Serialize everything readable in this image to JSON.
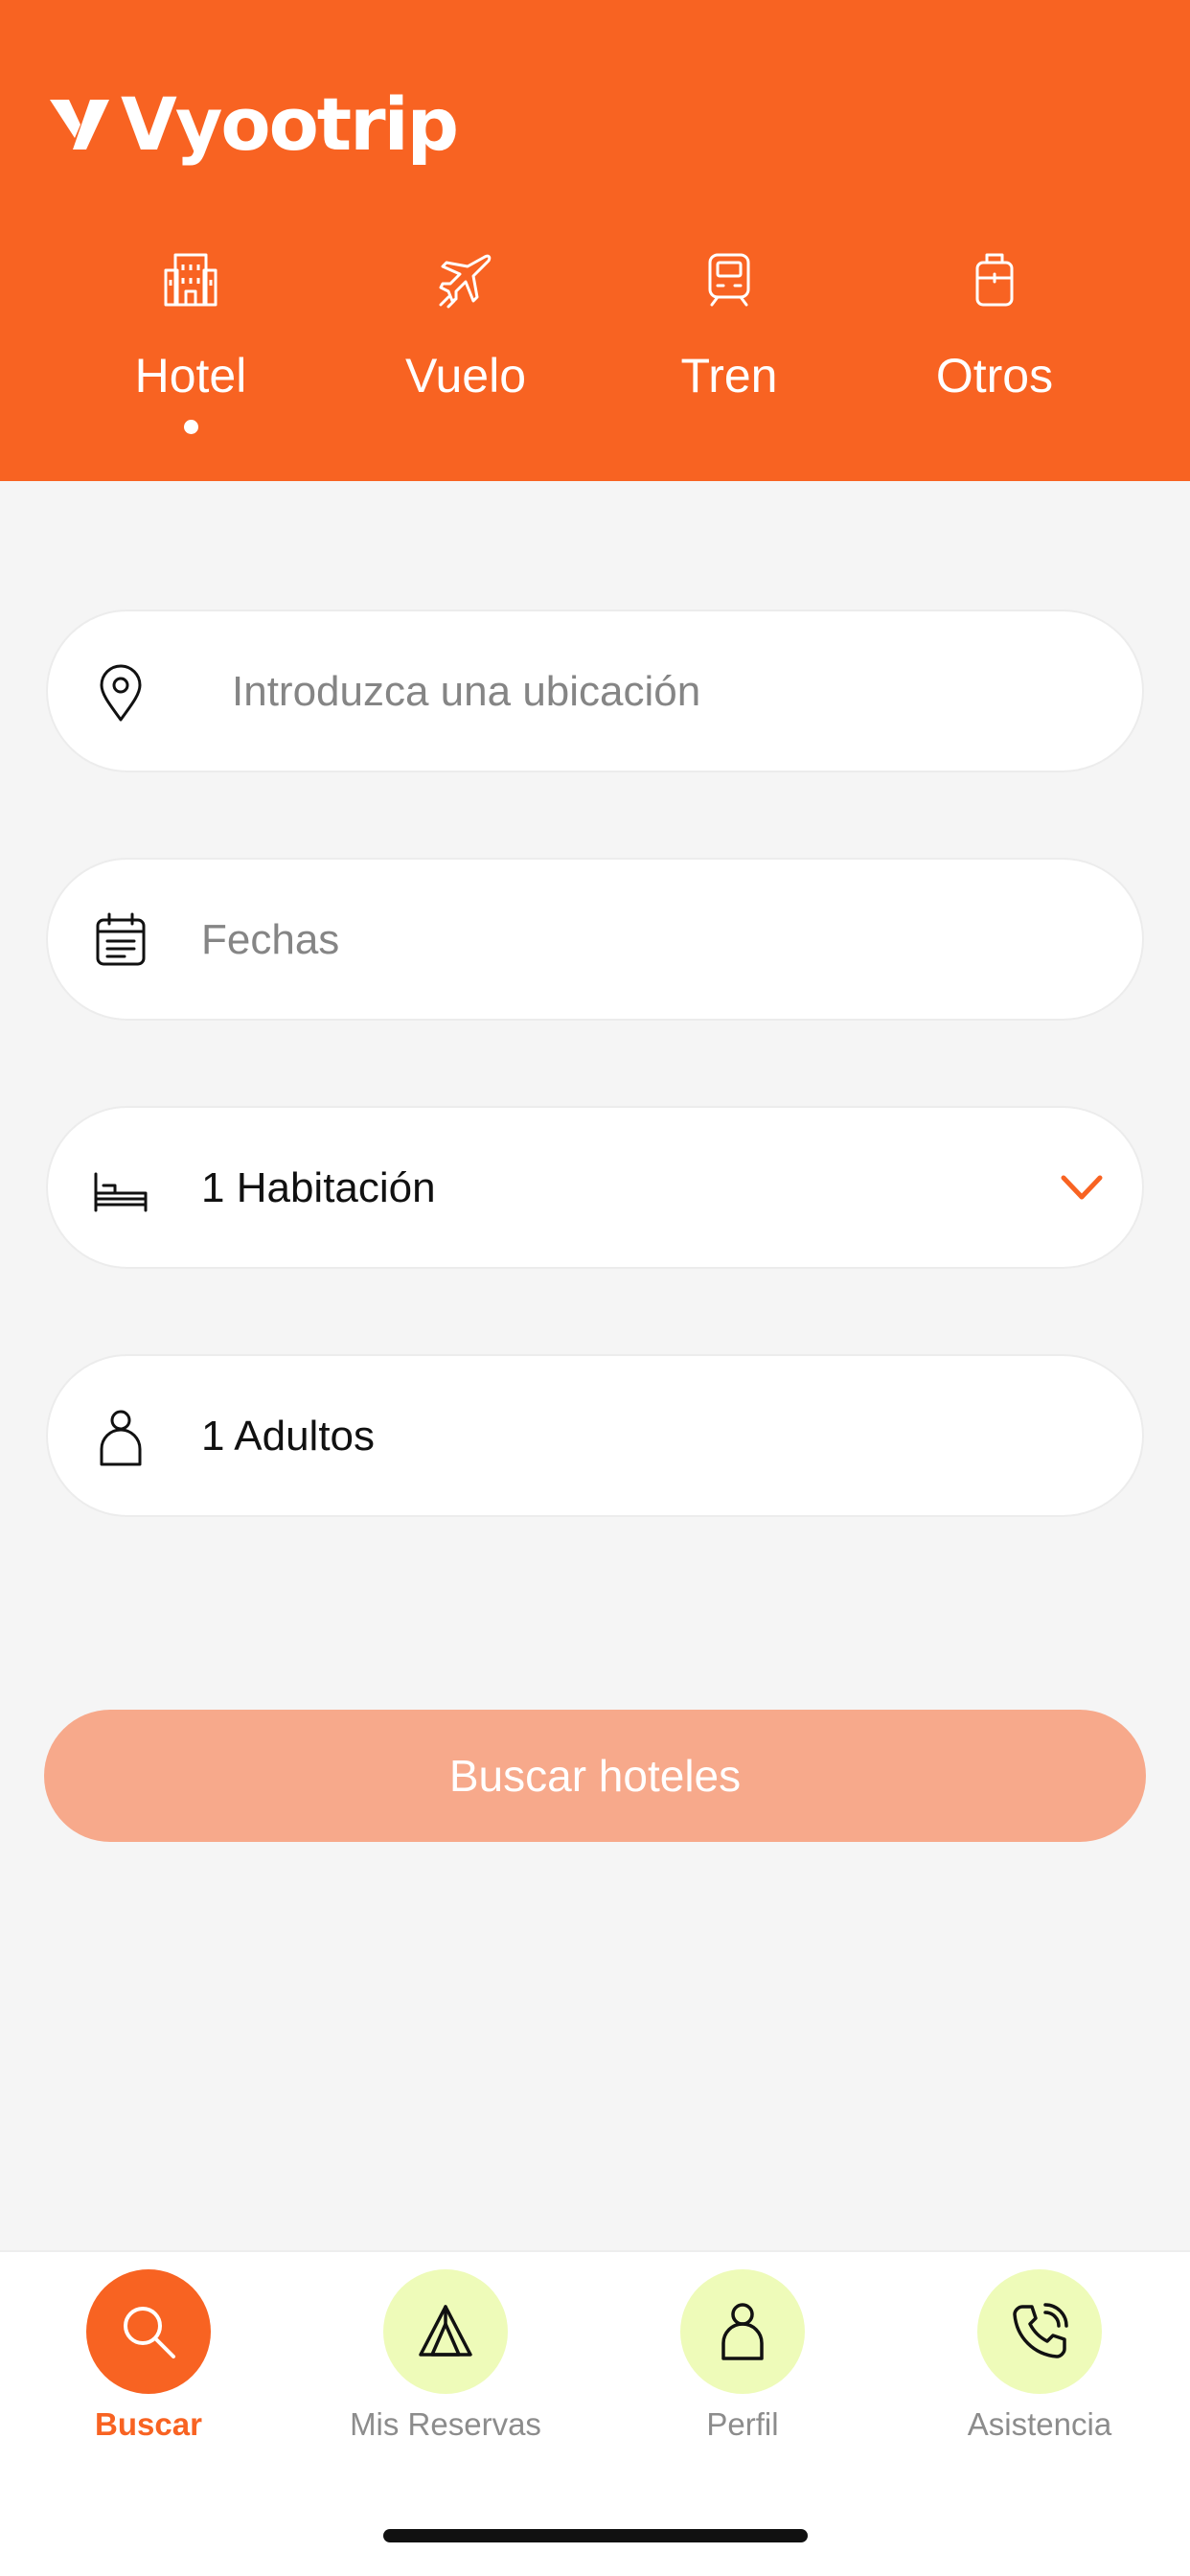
{
  "brand": {
    "name": "Vyootrip"
  },
  "colors": {
    "primary": "#f86322",
    "button_disabled": "#f7a98b",
    "nav_bubble": "#eefbb9",
    "background": "#f5f5f5"
  },
  "tabs": [
    {
      "label": "Hotel",
      "icon": "hotel-icon",
      "active": true
    },
    {
      "label": "Vuelo",
      "icon": "plane-icon",
      "active": false
    },
    {
      "label": "Tren",
      "icon": "train-icon",
      "active": false
    },
    {
      "label": "Otros",
      "icon": "luggage-icon",
      "active": false
    }
  ],
  "form": {
    "location": {
      "placeholder": "Introduzca una ubicación",
      "icon": "location-pin-icon"
    },
    "dates": {
      "placeholder": "Fechas",
      "icon": "calendar-icon"
    },
    "rooms": {
      "value": "1 Habitación",
      "icon": "bed-icon",
      "dropdown_icon": "chevron-down-icon"
    },
    "guests": {
      "value": "1 Adultos",
      "icon": "person-icon"
    },
    "submit_label": "Buscar hoteles"
  },
  "bottom_nav": [
    {
      "label": "Buscar",
      "icon": "search-icon",
      "active": true
    },
    {
      "label": "Mis Reservas",
      "icon": "tent-icon",
      "active": false
    },
    {
      "label": "Perfil",
      "icon": "profile-icon",
      "active": false
    },
    {
      "label": "Asistencia",
      "icon": "phone-icon",
      "active": false
    }
  ]
}
